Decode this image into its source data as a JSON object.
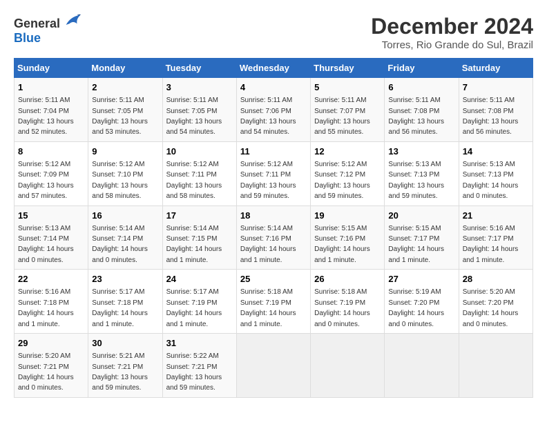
{
  "logo": {
    "general": "General",
    "blue": "Blue"
  },
  "title": "December 2024",
  "subtitle": "Torres, Rio Grande do Sul, Brazil",
  "days_header": [
    "Sunday",
    "Monday",
    "Tuesday",
    "Wednesday",
    "Thursday",
    "Friday",
    "Saturday"
  ],
  "weeks": [
    [
      {
        "day": "1",
        "sunrise": "5:11 AM",
        "sunset": "7:04 PM",
        "daylight": "13 hours and 52 minutes."
      },
      {
        "day": "2",
        "sunrise": "5:11 AM",
        "sunset": "7:05 PM",
        "daylight": "13 hours and 53 minutes."
      },
      {
        "day": "3",
        "sunrise": "5:11 AM",
        "sunset": "7:05 PM",
        "daylight": "13 hours and 54 minutes."
      },
      {
        "day": "4",
        "sunrise": "5:11 AM",
        "sunset": "7:06 PM",
        "daylight": "13 hours and 54 minutes."
      },
      {
        "day": "5",
        "sunrise": "5:11 AM",
        "sunset": "7:07 PM",
        "daylight": "13 hours and 55 minutes."
      },
      {
        "day": "6",
        "sunrise": "5:11 AM",
        "sunset": "7:08 PM",
        "daylight": "13 hours and 56 minutes."
      },
      {
        "day": "7",
        "sunrise": "5:11 AM",
        "sunset": "7:08 PM",
        "daylight": "13 hours and 56 minutes."
      }
    ],
    [
      {
        "day": "8",
        "sunrise": "5:12 AM",
        "sunset": "7:09 PM",
        "daylight": "13 hours and 57 minutes."
      },
      {
        "day": "9",
        "sunrise": "5:12 AM",
        "sunset": "7:10 PM",
        "daylight": "13 hours and 58 minutes."
      },
      {
        "day": "10",
        "sunrise": "5:12 AM",
        "sunset": "7:11 PM",
        "daylight": "13 hours and 58 minutes."
      },
      {
        "day": "11",
        "sunrise": "5:12 AM",
        "sunset": "7:11 PM",
        "daylight": "13 hours and 59 minutes."
      },
      {
        "day": "12",
        "sunrise": "5:12 AM",
        "sunset": "7:12 PM",
        "daylight": "13 hours and 59 minutes."
      },
      {
        "day": "13",
        "sunrise": "5:13 AM",
        "sunset": "7:13 PM",
        "daylight": "13 hours and 59 minutes."
      },
      {
        "day": "14",
        "sunrise": "5:13 AM",
        "sunset": "7:13 PM",
        "daylight": "14 hours and 0 minutes."
      }
    ],
    [
      {
        "day": "15",
        "sunrise": "5:13 AM",
        "sunset": "7:14 PM",
        "daylight": "14 hours and 0 minutes."
      },
      {
        "day": "16",
        "sunrise": "5:14 AM",
        "sunset": "7:14 PM",
        "daylight": "14 hours and 0 minutes."
      },
      {
        "day": "17",
        "sunrise": "5:14 AM",
        "sunset": "7:15 PM",
        "daylight": "14 hours and 1 minute."
      },
      {
        "day": "18",
        "sunrise": "5:14 AM",
        "sunset": "7:16 PM",
        "daylight": "14 hours and 1 minute."
      },
      {
        "day": "19",
        "sunrise": "5:15 AM",
        "sunset": "7:16 PM",
        "daylight": "14 hours and 1 minute."
      },
      {
        "day": "20",
        "sunrise": "5:15 AM",
        "sunset": "7:17 PM",
        "daylight": "14 hours and 1 minute."
      },
      {
        "day": "21",
        "sunrise": "5:16 AM",
        "sunset": "7:17 PM",
        "daylight": "14 hours and 1 minute."
      }
    ],
    [
      {
        "day": "22",
        "sunrise": "5:16 AM",
        "sunset": "7:18 PM",
        "daylight": "14 hours and 1 minute."
      },
      {
        "day": "23",
        "sunrise": "5:17 AM",
        "sunset": "7:18 PM",
        "daylight": "14 hours and 1 minute."
      },
      {
        "day": "24",
        "sunrise": "5:17 AM",
        "sunset": "7:19 PM",
        "daylight": "14 hours and 1 minute."
      },
      {
        "day": "25",
        "sunrise": "5:18 AM",
        "sunset": "7:19 PM",
        "daylight": "14 hours and 1 minute."
      },
      {
        "day": "26",
        "sunrise": "5:18 AM",
        "sunset": "7:19 PM",
        "daylight": "14 hours and 0 minutes."
      },
      {
        "day": "27",
        "sunrise": "5:19 AM",
        "sunset": "7:20 PM",
        "daylight": "14 hours and 0 minutes."
      },
      {
        "day": "28",
        "sunrise": "5:20 AM",
        "sunset": "7:20 PM",
        "daylight": "14 hours and 0 minutes."
      }
    ],
    [
      {
        "day": "29",
        "sunrise": "5:20 AM",
        "sunset": "7:21 PM",
        "daylight": "14 hours and 0 minutes."
      },
      {
        "day": "30",
        "sunrise": "5:21 AM",
        "sunset": "7:21 PM",
        "daylight": "13 hours and 59 minutes."
      },
      {
        "day": "31",
        "sunrise": "5:22 AM",
        "sunset": "7:21 PM",
        "daylight": "13 hours and 59 minutes."
      },
      null,
      null,
      null,
      null
    ]
  ]
}
